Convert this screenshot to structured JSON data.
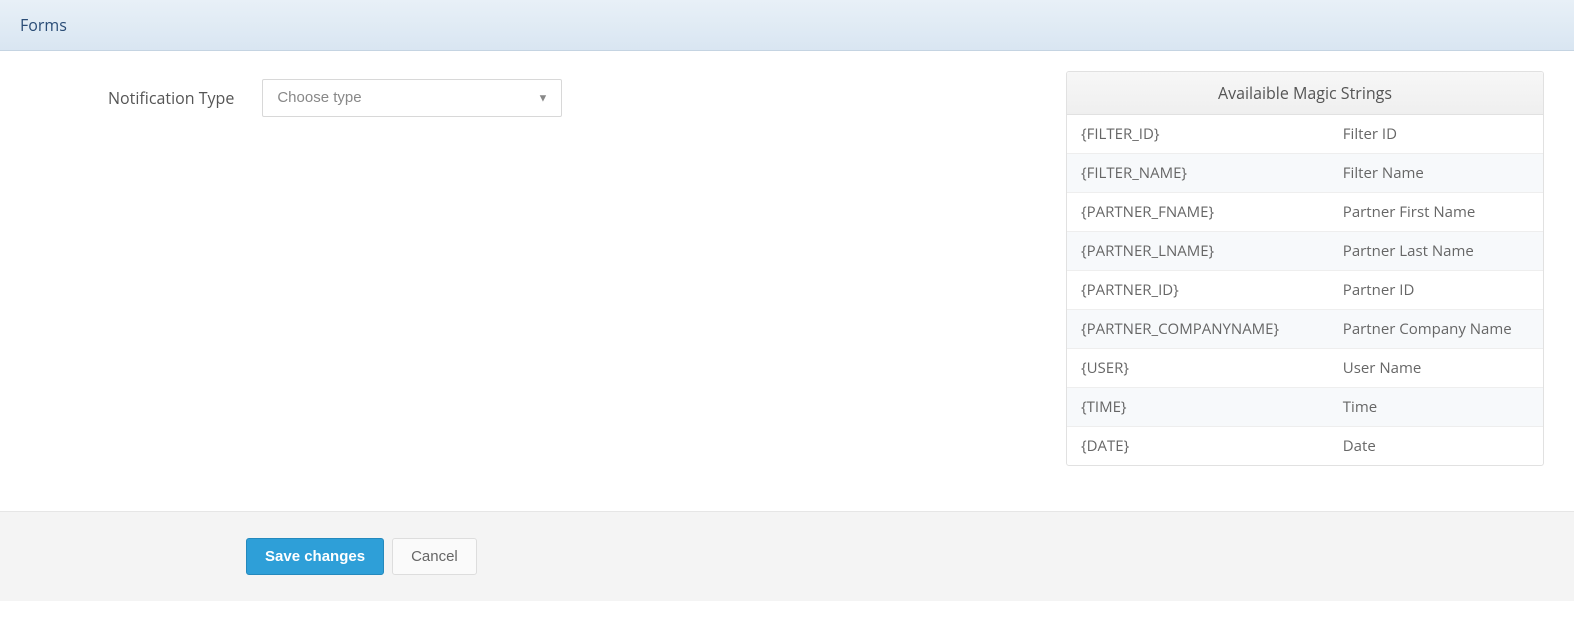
{
  "header": {
    "title": "Forms"
  },
  "form": {
    "notification_type_label": "Notification Type",
    "notification_type_placeholder": "Choose type"
  },
  "magic": {
    "header": "Availaible Magic Strings",
    "rows": [
      {
        "token": "{FILTER_ID}",
        "desc": "Filter ID"
      },
      {
        "token": "{FILTER_NAME}",
        "desc": "Filter Name"
      },
      {
        "token": "{PARTNER_FNAME}",
        "desc": "Partner First Name"
      },
      {
        "token": "{PARTNER_LNAME}",
        "desc": "Partner Last Name"
      },
      {
        "token": "{PARTNER_ID}",
        "desc": "Partner ID"
      },
      {
        "token": "{PARTNER_COMPANYNAME}",
        "desc": "Partner Company Name"
      },
      {
        "token": "{USER}",
        "desc": "User Name"
      },
      {
        "token": "{TIME}",
        "desc": "Time"
      },
      {
        "token": "{DATE}",
        "desc": "Date"
      }
    ]
  },
  "footer": {
    "save_label": "Save changes",
    "cancel_label": "Cancel"
  }
}
